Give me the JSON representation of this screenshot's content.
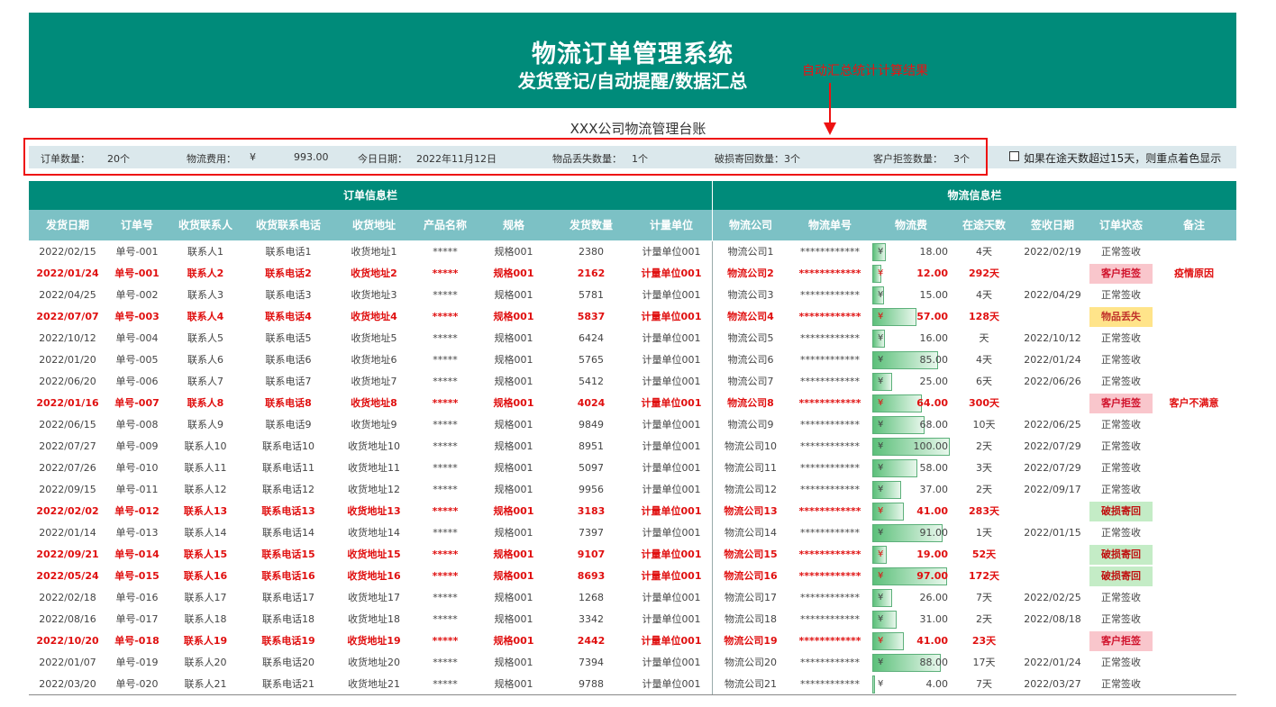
{
  "header": {
    "title": "物流订单管理系统",
    "subtitle": "发货登记/自动提醒/数据汇总"
  },
  "annotation": "自动汇总统计计算结果",
  "ledger_title": "XXX公司物流管理台账",
  "summary": {
    "order_count_label": "订单数量：",
    "order_count": "20个",
    "fee_label": "物流费用：",
    "fee_currency": "¥",
    "fee_total": "993.00",
    "today_label": "今日日期：",
    "today": "2022年11月12日",
    "lost_label": "物品丢失数量：",
    "lost": "1个",
    "damage_text": "破损寄回数量：3个",
    "reject_label": "客户拒签数量：",
    "reject": "3个"
  },
  "checkbox_label": "如果在途天数超过15天，则重点着色显示",
  "sections": {
    "order": "订单信息栏",
    "logistics": "物流信息栏"
  },
  "columns": [
    "发货日期",
    "订单号",
    "收货联系人",
    "收货联系电话",
    "收货地址",
    "产品名称",
    "规格",
    "发货数量",
    "计量单位",
    "物流公司",
    "物流单号",
    "物流费",
    "在途天数",
    "签收日期",
    "订单状态",
    "备注"
  ],
  "colors": {
    "header_green": "#008b7a",
    "column_head": "#7cc1c5",
    "alert_red": "#e01010",
    "reject_pink": "#f9c6cc",
    "lost_yellow": "#ffe48a",
    "damage_green": "#c4ecc6"
  },
  "rows": [
    {
      "date": "2022/02/15",
      "order": "单号-001",
      "contact": "联系人1",
      "phone": "联系电话1",
      "addr": "收货地址1",
      "product": "*****",
      "spec": "规格001",
      "qty": "2380",
      "unit": "计量单位001",
      "company": "物流公司1",
      "tracking": "************",
      "fee": 18,
      "fee_text": "18.00",
      "days": "4天",
      "signed": "2022/02/19",
      "status": "正常签收",
      "status_type": "normal",
      "note": "",
      "alert": false
    },
    {
      "date": "2022/01/24",
      "order": "单号-001",
      "contact": "联系人2",
      "phone": "联系电话2",
      "addr": "收货地址2",
      "product": "*****",
      "spec": "规格001",
      "qty": "2162",
      "unit": "计量单位001",
      "company": "物流公司2",
      "tracking": "************",
      "fee": 12,
      "fee_text": "12.00",
      "days": "292天",
      "signed": "",
      "status": "客户拒签",
      "status_type": "reject",
      "note": "疫情原因",
      "alert": true
    },
    {
      "date": "2022/04/25",
      "order": "单号-002",
      "contact": "联系人3",
      "phone": "联系电话3",
      "addr": "收货地址3",
      "product": "*****",
      "spec": "规格001",
      "qty": "5781",
      "unit": "计量单位001",
      "company": "物流公司3",
      "tracking": "************",
      "fee": 15,
      "fee_text": "15.00",
      "days": "4天",
      "signed": "2022/04/29",
      "status": "正常签收",
      "status_type": "normal",
      "note": "",
      "alert": false
    },
    {
      "date": "2022/07/07",
      "order": "单号-003",
      "contact": "联系人4",
      "phone": "联系电话4",
      "addr": "收货地址4",
      "product": "*****",
      "spec": "规格001",
      "qty": "5837",
      "unit": "计量单位001",
      "company": "物流公司4",
      "tracking": "************",
      "fee": 57,
      "fee_text": "57.00",
      "days": "128天",
      "signed": "",
      "status": "物品丢失",
      "status_type": "lost",
      "note": "",
      "alert": true
    },
    {
      "date": "2022/10/12",
      "order": "单号-004",
      "contact": "联系人5",
      "phone": "联系电话5",
      "addr": "收货地址5",
      "product": "*****",
      "spec": "规格001",
      "qty": "6424",
      "unit": "计量单位001",
      "company": "物流公司5",
      "tracking": "************",
      "fee": 16,
      "fee_text": "16.00",
      "days": "天",
      "signed": "2022/10/12",
      "status": "正常签收",
      "status_type": "normal",
      "note": "",
      "alert": false
    },
    {
      "date": "2022/01/20",
      "order": "单号-005",
      "contact": "联系人6",
      "phone": "联系电话6",
      "addr": "收货地址6",
      "product": "*****",
      "spec": "规格001",
      "qty": "5765",
      "unit": "计量单位001",
      "company": "物流公司6",
      "tracking": "************",
      "fee": 85,
      "fee_text": "85.00",
      "days": "4天",
      "signed": "2022/01/24",
      "status": "正常签收",
      "status_type": "normal",
      "note": "",
      "alert": false
    },
    {
      "date": "2022/06/20",
      "order": "单号-006",
      "contact": "联系人7",
      "phone": "联系电话7",
      "addr": "收货地址7",
      "product": "*****",
      "spec": "规格001",
      "qty": "5412",
      "unit": "计量单位001",
      "company": "物流公司7",
      "tracking": "************",
      "fee": 25,
      "fee_text": "25.00",
      "days": "6天",
      "signed": "2022/06/26",
      "status": "正常签收",
      "status_type": "normal",
      "note": "",
      "alert": false
    },
    {
      "date": "2022/01/16",
      "order": "单号-007",
      "contact": "联系人8",
      "phone": "联系电话8",
      "addr": "收货地址8",
      "product": "*****",
      "spec": "规格001",
      "qty": "4024",
      "unit": "计量单位001",
      "company": "物流公司8",
      "tracking": "************",
      "fee": 64,
      "fee_text": "64.00",
      "days": "300天",
      "signed": "",
      "status": "客户拒签",
      "status_type": "reject",
      "note": "客户不满意",
      "alert": true
    },
    {
      "date": "2022/06/15",
      "order": "单号-008",
      "contact": "联系人9",
      "phone": "联系电话9",
      "addr": "收货地址9",
      "product": "*****",
      "spec": "规格001",
      "qty": "9849",
      "unit": "计量单位001",
      "company": "物流公司9",
      "tracking": "************",
      "fee": 68,
      "fee_text": "68.00",
      "days": "10天",
      "signed": "2022/06/25",
      "status": "正常签收",
      "status_type": "normal",
      "note": "",
      "alert": false
    },
    {
      "date": "2022/07/27",
      "order": "单号-009",
      "contact": "联系人10",
      "phone": "联系电话10",
      "addr": "收货地址10",
      "product": "*****",
      "spec": "规格001",
      "qty": "8951",
      "unit": "计量单位001",
      "company": "物流公司10",
      "tracking": "************",
      "fee": 100,
      "fee_text": "100.00",
      "days": "2天",
      "signed": "2022/07/29",
      "status": "正常签收",
      "status_type": "normal",
      "note": "",
      "alert": false
    },
    {
      "date": "2022/07/26",
      "order": "单号-010",
      "contact": "联系人11",
      "phone": "联系电话11",
      "addr": "收货地址11",
      "product": "*****",
      "spec": "规格001",
      "qty": "5097",
      "unit": "计量单位001",
      "company": "物流公司11",
      "tracking": "************",
      "fee": 58,
      "fee_text": "58.00",
      "days": "3天",
      "signed": "2022/07/29",
      "status": "正常签收",
      "status_type": "normal",
      "note": "",
      "alert": false
    },
    {
      "date": "2022/09/15",
      "order": "单号-011",
      "contact": "联系人12",
      "phone": "联系电话12",
      "addr": "收货地址12",
      "product": "*****",
      "spec": "规格001",
      "qty": "9956",
      "unit": "计量单位001",
      "company": "物流公司12",
      "tracking": "************",
      "fee": 37,
      "fee_text": "37.00",
      "days": "2天",
      "signed": "2022/09/17",
      "status": "正常签收",
      "status_type": "normal",
      "note": "",
      "alert": false
    },
    {
      "date": "2022/02/02",
      "order": "单号-012",
      "contact": "联系人13",
      "phone": "联系电话13",
      "addr": "收货地址13",
      "product": "*****",
      "spec": "规格001",
      "qty": "3183",
      "unit": "计量单位001",
      "company": "物流公司13",
      "tracking": "************",
      "fee": 41,
      "fee_text": "41.00",
      "days": "283天",
      "signed": "",
      "status": "破损寄回",
      "status_type": "damage",
      "note": "",
      "alert": true
    },
    {
      "date": "2022/01/14",
      "order": "单号-013",
      "contact": "联系人14",
      "phone": "联系电话14",
      "addr": "收货地址14",
      "product": "*****",
      "spec": "规格001",
      "qty": "7397",
      "unit": "计量单位001",
      "company": "物流公司14",
      "tracking": "************",
      "fee": 91,
      "fee_text": "91.00",
      "days": "1天",
      "signed": "2022/01/15",
      "status": "正常签收",
      "status_type": "normal",
      "note": "",
      "alert": false
    },
    {
      "date": "2022/09/21",
      "order": "单号-014",
      "contact": "联系人15",
      "phone": "联系电话15",
      "addr": "收货地址15",
      "product": "*****",
      "spec": "规格001",
      "qty": "9107",
      "unit": "计量单位001",
      "company": "物流公司15",
      "tracking": "************",
      "fee": 19,
      "fee_text": "19.00",
      "days": "52天",
      "signed": "",
      "status": "破损寄回",
      "status_type": "damage",
      "note": "",
      "alert": true
    },
    {
      "date": "2022/05/24",
      "order": "单号-015",
      "contact": "联系人16",
      "phone": "联系电话16",
      "addr": "收货地址16",
      "product": "*****",
      "spec": "规格001",
      "qty": "8693",
      "unit": "计量单位001",
      "company": "物流公司16",
      "tracking": "************",
      "fee": 97,
      "fee_text": "97.00",
      "days": "172天",
      "signed": "",
      "status": "破损寄回",
      "status_type": "damage",
      "note": "",
      "alert": true
    },
    {
      "date": "2022/02/18",
      "order": "单号-016",
      "contact": "联系人17",
      "phone": "联系电话17",
      "addr": "收货地址17",
      "product": "*****",
      "spec": "规格001",
      "qty": "1268",
      "unit": "计量单位001",
      "company": "物流公司17",
      "tracking": "************",
      "fee": 26,
      "fee_text": "26.00",
      "days": "7天",
      "signed": "2022/02/25",
      "status": "正常签收",
      "status_type": "normal",
      "note": "",
      "alert": false
    },
    {
      "date": "2022/08/16",
      "order": "单号-017",
      "contact": "联系人18",
      "phone": "联系电话18",
      "addr": "收货地址18",
      "product": "*****",
      "spec": "规格001",
      "qty": "3342",
      "unit": "计量单位001",
      "company": "物流公司18",
      "tracking": "************",
      "fee": 31,
      "fee_text": "31.00",
      "days": "2天",
      "signed": "2022/08/18",
      "status": "正常签收",
      "status_type": "normal",
      "note": "",
      "alert": false
    },
    {
      "date": "2022/10/20",
      "order": "单号-018",
      "contact": "联系人19",
      "phone": "联系电话19",
      "addr": "收货地址19",
      "product": "*****",
      "spec": "规格001",
      "qty": "2442",
      "unit": "计量单位001",
      "company": "物流公司19",
      "tracking": "************",
      "fee": 41,
      "fee_text": "41.00",
      "days": "23天",
      "signed": "",
      "status": "客户拒签",
      "status_type": "reject",
      "note": "",
      "alert": true
    },
    {
      "date": "2022/01/07",
      "order": "单号-019",
      "contact": "联系人20",
      "phone": "联系电话20",
      "addr": "收货地址20",
      "product": "*****",
      "spec": "规格001",
      "qty": "7394",
      "unit": "计量单位001",
      "company": "物流公司20",
      "tracking": "************",
      "fee": 88,
      "fee_text": "88.00",
      "days": "17天",
      "signed": "2022/01/24",
      "status": "正常签收",
      "status_type": "normal",
      "note": "",
      "alert": false
    },
    {
      "date": "2022/03/20",
      "order": "单号-020",
      "contact": "联系人21",
      "phone": "联系电话21",
      "addr": "收货地址21",
      "product": "*****",
      "spec": "规格001",
      "qty": "9788",
      "unit": "计量单位001",
      "company": "物流公司21",
      "tracking": "************",
      "fee": 4,
      "fee_text": "4.00",
      "days": "7天",
      "signed": "2022/03/27",
      "status": "正常签收",
      "status_type": "normal",
      "note": "",
      "alert": false
    }
  ]
}
